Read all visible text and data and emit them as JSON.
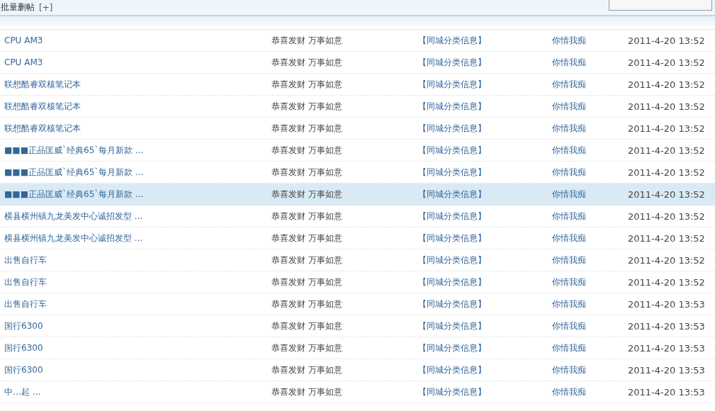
{
  "toolbar": {
    "batch_delete": "批量删帖",
    "expand": "[+]"
  },
  "rows": [
    {
      "title": "CPU AM3",
      "subject": "恭喜发财 万事如意",
      "forum": "【同城分类信息】",
      "author": "你情我痴",
      "date": "2011-4-20 13:52",
      "selected": false
    },
    {
      "title": "CPU AM3",
      "subject": "恭喜发财 万事如意",
      "forum": "【同城分类信息】",
      "author": "你情我痴",
      "date": "2011-4-20 13:52",
      "selected": false
    },
    {
      "title": "联想酷睿双核笔记本",
      "subject": "恭喜发财 万事如意",
      "forum": "【同城分类信息】",
      "author": "你情我痴",
      "date": "2011-4-20 13:52",
      "selected": false
    },
    {
      "title": "联想酷睿双核笔记本",
      "subject": "恭喜发财 万事如意",
      "forum": "【同城分类信息】",
      "author": "你情我痴",
      "date": "2011-4-20 13:52",
      "selected": false
    },
    {
      "title": "联想酷睿双核笔记本",
      "subject": "恭喜发财 万事如意",
      "forum": "【同城分类信息】",
      "author": "你情我痴",
      "date": "2011-4-20 13:52",
      "selected": false
    },
    {
      "title": "■■■正品匡威`经典65`每月新款 ...",
      "subject": "恭喜发财 万事如意",
      "forum": "【同城分类信息】",
      "author": "你情我痴",
      "date": "2011-4-20 13:52",
      "selected": false
    },
    {
      "title": "■■■正品匡威`经典65`每月新款 ...",
      "subject": "恭喜发财 万事如意",
      "forum": "【同城分类信息】",
      "author": "你情我痴",
      "date": "2011-4-20 13:52",
      "selected": false
    },
    {
      "title": "■■■正品匡威`经典65`每月新款 ...",
      "subject": "恭喜发财 万事如意",
      "forum": "【同城分类信息】",
      "author": "你情我痴",
      "date": "2011-4-20 13:52",
      "selected": true
    },
    {
      "title": "横县横州镇九龙美发中心诚招发型 ...",
      "subject": "恭喜发财 万事如意",
      "forum": "【同城分类信息】",
      "author": "你情我痴",
      "date": "2011-4-20 13:52",
      "selected": false
    },
    {
      "title": "横县横州镇九龙美发中心诚招发型 ...",
      "subject": "恭喜发财 万事如意",
      "forum": "【同城分类信息】",
      "author": "你情我痴",
      "date": "2011-4-20 13:52",
      "selected": false
    },
    {
      "title": "出售自行车",
      "subject": "恭喜发财 万事如意",
      "forum": "【同城分类信息】",
      "author": "你情我痴",
      "date": "2011-4-20 13:52",
      "selected": false
    },
    {
      "title": "出售自行车",
      "subject": "恭喜发财 万事如意",
      "forum": "【同城分类信息】",
      "author": "你情我痴",
      "date": "2011-4-20 13:52",
      "selected": false
    },
    {
      "title": "出售自行车",
      "subject": "恭喜发财 万事如意",
      "forum": "【同城分类信息】",
      "author": "你情我痴",
      "date": "2011-4-20 13:53",
      "selected": false
    },
    {
      "title": "国行6300",
      "subject": "恭喜发财 万事如意",
      "forum": "【同城分类信息】",
      "author": "你情我痴",
      "date": "2011-4-20 13:53",
      "selected": false
    },
    {
      "title": "国行6300",
      "subject": "恭喜发财 万事如意",
      "forum": "【同城分类信息】",
      "author": "你情我痴",
      "date": "2011-4-20 13:53",
      "selected": false
    },
    {
      "title": "国行6300",
      "subject": "恭喜发财 万事如意",
      "forum": "【同城分类信息】",
      "author": "你情我痴",
      "date": "2011-4-20 13:53",
      "selected": false
    },
    {
      "title": "中…起 ...",
      "subject": "恭喜发财 万事如意",
      "forum": "【同城分类信息】",
      "author": "你情我痴",
      "date": "2011-4-20 13:53",
      "selected": false
    }
  ]
}
